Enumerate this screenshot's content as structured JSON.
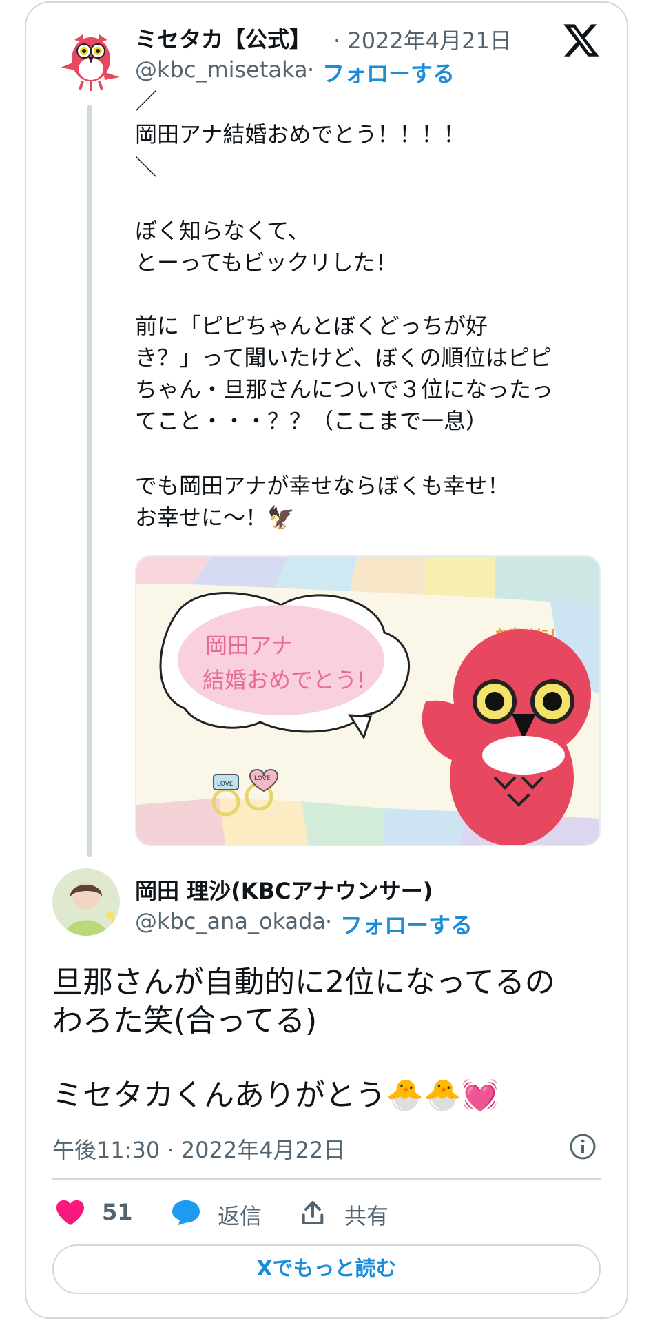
{
  "original_tweet": {
    "author_name": "ミセタカ【公式】",
    "date": "· 2022年4月21日",
    "handle": "@kbc_misetaka",
    "follow_label": "フォローする",
    "lines": [
      "／",
      "岡田アナ結婚おめでとう！！！！",
      "＼",
      "",
      "ぼく知らなくて、",
      "とーってもビックリした！",
      "",
      "前に「ピピちゃんとぼくどっちが好",
      "き？」って聞いたけど、ぼくの順位はピピ",
      "ちゃん・旦那さんについで３位になったっ",
      "てこと・・・？？（ここまで一息）",
      "",
      "でも岡田アナが幸せならぼくも幸せ！",
      "お幸せに～！🦅"
    ],
    "image": {
      "bubble_text_line1": "岡田アナ",
      "bubble_text_line2": "結婚おめでとう!",
      "corner_text": "お幸せに!",
      "ring_label_1": "LOVE",
      "ring_label_2": "LOVE"
    }
  },
  "reply_tweet": {
    "author_name": "岡田 理沙(KBCアナウンサー)",
    "handle": "@kbc_ana_okada",
    "follow_label": "フォローする",
    "text_line1": "旦那さんが自動的に2位になってるの",
    "text_line2": "わろた笑(合ってる)",
    "text_line3": "ミセタカくんありがとう🐣🐣💓",
    "timestamp": "午後11:30 · 2022年4月22日"
  },
  "actions": {
    "like_count": "51",
    "reply_label": "返信",
    "share_label": "共有"
  },
  "read_more_label": "Xでもっと読む",
  "colors": {
    "link": "#1a8cd8",
    "like": "#f91880",
    "reply_icon": "#1d9bf0",
    "muted": "#536471",
    "mascot_red": "#e8485f"
  }
}
